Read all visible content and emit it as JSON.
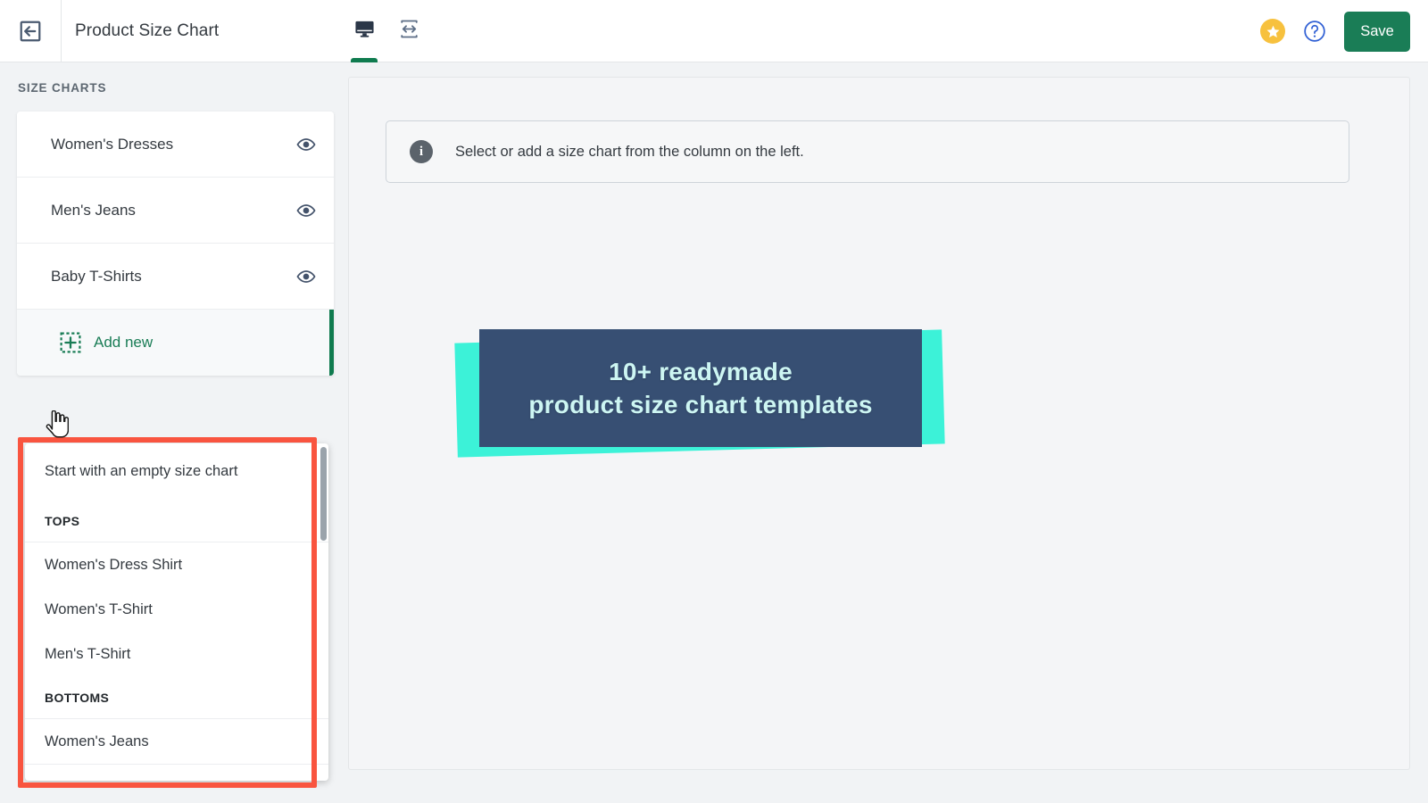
{
  "topbar": {
    "back_icon": "exit-left-arrow-icon",
    "title": "Product Size Chart",
    "device_tabs": [
      {
        "icon": "desktop-monitor-icon",
        "active": true
      },
      {
        "icon": "responsive-resize-icon",
        "active": false
      }
    ],
    "star_icon": "star-icon",
    "help_icon": "question-mark-circle-icon",
    "save_label": "Save"
  },
  "sidebar": {
    "heading": "SIZE CHARTS",
    "items": [
      {
        "label": "Women's Dresses",
        "eye_icon": "eye-icon"
      },
      {
        "label": "Men's Jeans",
        "eye_icon": "eye-icon"
      },
      {
        "label": "Baby T-Shirts",
        "eye_icon": "eye-icon"
      }
    ],
    "add_new": {
      "label": "Add new",
      "icon": "dashed-plus-square-icon"
    }
  },
  "dropdown": {
    "empty_option": "Start with an empty size chart",
    "groups": [
      {
        "title": "TOPS",
        "items": [
          "Women's Dress Shirt",
          "Women's T-Shirt",
          "Men's T-Shirt"
        ]
      },
      {
        "title": "BOTTOMS",
        "items": [
          "Women's Jeans"
        ]
      }
    ]
  },
  "main": {
    "info_icon": "info-icon",
    "info_text": "Select or add a size chart from the column on the left.",
    "promo": {
      "line1": "10+ readymade",
      "line2": "product size chart templates"
    }
  },
  "colors": {
    "accent_green": "#1a7d56",
    "highlight_red": "#f9543f",
    "promo_cyan": "#3cf2d8",
    "promo_navy": "#374f73",
    "promo_text": "#cdf6f3",
    "star_yellow": "#f7c13e",
    "help_blue": "#2f5fd4",
    "icon_slate": "#4a5a70"
  },
  "cursor": {
    "type": "pointing-hand-cursor"
  }
}
